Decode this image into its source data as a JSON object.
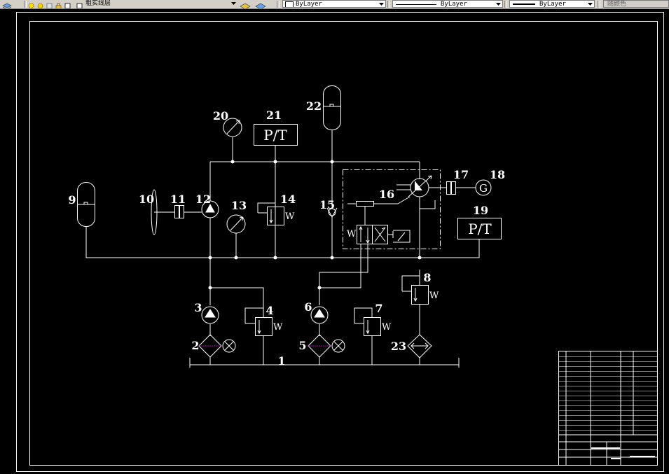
{
  "toolbar": {
    "layer_name": "粗实线层",
    "color_value": "ByLayer",
    "linetype_value": "ByLayer",
    "lineweight_value": "ByLayer",
    "plotstyle_value": "随颜色"
  },
  "drawing": {
    "components": {
      "n1": "1",
      "n2": "2",
      "n3": "3",
      "n4": "4",
      "n5": "5",
      "n6": "6",
      "n7": "7",
      "n8": "8",
      "n9": "9",
      "n10": "10",
      "n11": "11",
      "n12": "12",
      "n13": "13",
      "n14": "14",
      "n15": "15",
      "n16": "16",
      "n17": "17",
      "n18": "18",
      "n19": "19",
      "n20": "20",
      "n21": "21",
      "n22": "22",
      "n23": "23"
    },
    "sensor_label_21": "P/T",
    "sensor_label_19": "P/T",
    "generator_label": "G",
    "spring_mark": "W"
  },
  "colors": {
    "background": "#000000",
    "linework": "#ffffff",
    "filter_line": "#c000c0",
    "toolbar": "#d4d0c8"
  }
}
